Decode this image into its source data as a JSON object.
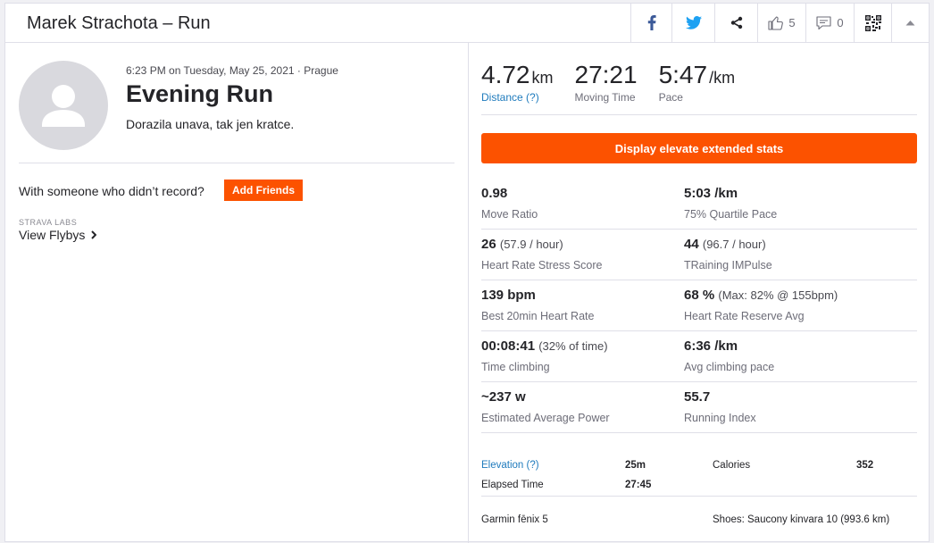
{
  "header": {
    "title": "Marek Strachota – Run",
    "kudos_count": "5",
    "comment_count": "0",
    "colors": {
      "facebook": "#3b5998",
      "twitter": "#1da1f2",
      "icon": "#6d6d78"
    }
  },
  "activity": {
    "date_location": "6:23 PM on Tuesday, May 25, 2021 · Prague",
    "name": "Evening Run",
    "description": "Dorazila unava, tak jen kratce.",
    "with_someone_text": "With someone who didn’t record?",
    "add_friends_label": "Add Friends",
    "labs_label": "STRAVA LABS",
    "flybys_label": "View Flybys"
  },
  "top_stats": [
    {
      "value": "4.72",
      "unit": "km",
      "label": "Distance (?)"
    },
    {
      "value": "27:21",
      "unit": "",
      "label": "Moving Time"
    },
    {
      "value": "5:47",
      "unit": "/km",
      "label": "Pace"
    }
  ],
  "elevate_button_label": "Display elevate extended stats",
  "extended_stats": [
    [
      {
        "value": "0.98",
        "extra": "",
        "label": "Move Ratio"
      },
      {
        "value": "5:03 /km",
        "extra": "",
        "label": "75% Quartile Pace"
      }
    ],
    [
      {
        "value": "26",
        "extra": "(57.9 / hour)",
        "label": "Heart Rate Stress Score"
      },
      {
        "value": "44",
        "extra": "(96.7 / hour)",
        "label": "TRaining IMPulse"
      }
    ],
    [
      {
        "value": "139 bpm",
        "extra": "",
        "label": "Best 20min Heart Rate"
      },
      {
        "value": "68 %",
        "extra": "(Max: 82% @ 155bpm)",
        "label": "Heart Rate Reserve Avg"
      }
    ],
    [
      {
        "value": "00:08:41",
        "extra": "(32% of time)",
        "label": "Time climbing"
      },
      {
        "value": "6:36 /km",
        "extra": "",
        "label": "Avg climbing pace"
      }
    ],
    [
      {
        "value": "~237 w",
        "extra": "",
        "label": "Estimated Average Power"
      },
      {
        "value": "55.7",
        "extra": "",
        "label": "Running Index"
      }
    ]
  ],
  "mini_stats": {
    "elevation_label": "Elevation (?)",
    "elevation_value": "25m",
    "calories_label": "Calories",
    "calories_value": "352",
    "elapsed_label": "Elapsed Time",
    "elapsed_value": "27:45"
  },
  "device": "Garmin fēnix 5",
  "shoes": "Shoes: Saucony kinvara 10 (993.6 km)",
  "colors": {
    "accent": "#fc5200",
    "link": "#1f7bbd"
  }
}
